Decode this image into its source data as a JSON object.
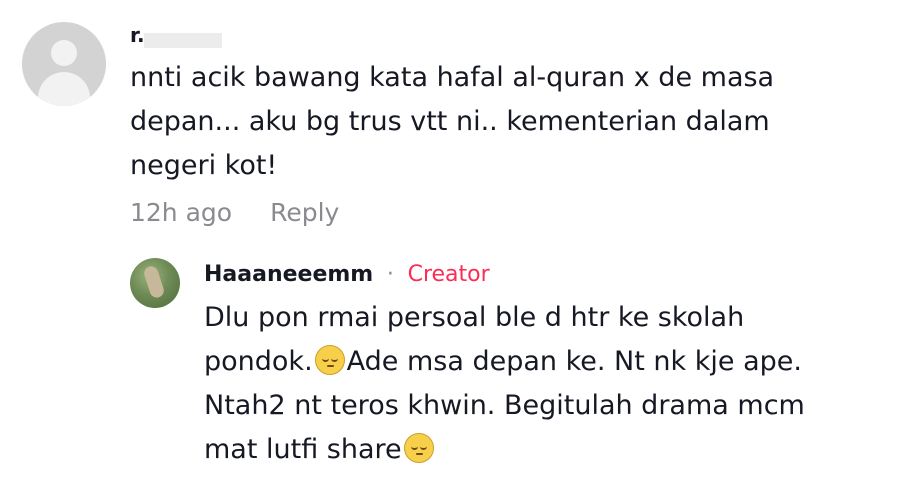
{
  "comment": {
    "username": "r.",
    "text": "nnti acik bawang kata hafal al-quran x de masa\ndepan... aku bg trus vtt ni.. kementerian dalam\nnegeri kot!",
    "time": "12h ago",
    "reply_label": "Reply"
  },
  "reply": {
    "username": "Haaaneeemm",
    "separator": "·",
    "badge": "Creator",
    "text_parts": [
      "Dlu pon rmai persoal ble d htr ke skolah",
      "pondok.",
      "Ade msa depan ke. Nt nk kje ape.",
      "Ntah2 nt teros khwin. Begitulah drama mcm",
      "mat lutfi share"
    ],
    "emoji": "pensive-face-icon"
  },
  "colors": {
    "text": "#161823",
    "muted": "#8a8b91",
    "creator": "#fe2c55"
  }
}
